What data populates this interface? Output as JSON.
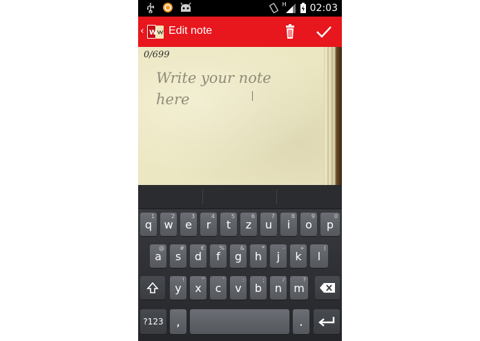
{
  "status_bar": {
    "time": "02:03",
    "left_icons": [
      "usb-icon",
      "cyanogen-icon",
      "android-debug-icon"
    ],
    "right_icons": [
      "rotation-icon",
      "signal-icon",
      "battery-icon"
    ],
    "network_label": "H"
  },
  "action_bar": {
    "title": "Edit note",
    "app_logo": "W",
    "color": "#e8161d",
    "actions": [
      "delete-icon",
      "confirm-check-icon"
    ]
  },
  "note": {
    "char_counter": "0/699",
    "placeholder": "Write your note here"
  },
  "keyboard": {
    "row1": [
      {
        "label": "q",
        "hint": "1"
      },
      {
        "label": "w",
        "hint": "2"
      },
      {
        "label": "e",
        "hint": "3"
      },
      {
        "label": "r",
        "hint": "4"
      },
      {
        "label": "t",
        "hint": "5"
      },
      {
        "label": "z",
        "hint": "6"
      },
      {
        "label": "u",
        "hint": "7"
      },
      {
        "label": "i",
        "hint": "8"
      },
      {
        "label": "o",
        "hint": "9"
      },
      {
        "label": "p",
        "hint": "0"
      }
    ],
    "row2": [
      {
        "label": "a",
        "hint": "@"
      },
      {
        "label": "s",
        "hint": "#"
      },
      {
        "label": "d",
        "hint": "€"
      },
      {
        "label": "f",
        "hint": "%"
      },
      {
        "label": "g",
        "hint": "&"
      },
      {
        "label": "h",
        "hint": "*"
      },
      {
        "label": "j",
        "hint": "-"
      },
      {
        "label": "k",
        "hint": "+"
      },
      {
        "label": "l",
        "hint": "("
      }
    ],
    "row3": [
      {
        "label": "y",
        "hint": "!"
      },
      {
        "label": "x",
        "hint": "\""
      },
      {
        "label": "c",
        "hint": "'"
      },
      {
        "label": "v",
        "hint": ":"
      },
      {
        "label": "b",
        "hint": ";"
      },
      {
        "label": "n",
        "hint": "/"
      },
      {
        "label": "m",
        "hint": "?"
      }
    ],
    "symbols_label": "?123",
    "comma_label": ",",
    "period_label": "."
  }
}
